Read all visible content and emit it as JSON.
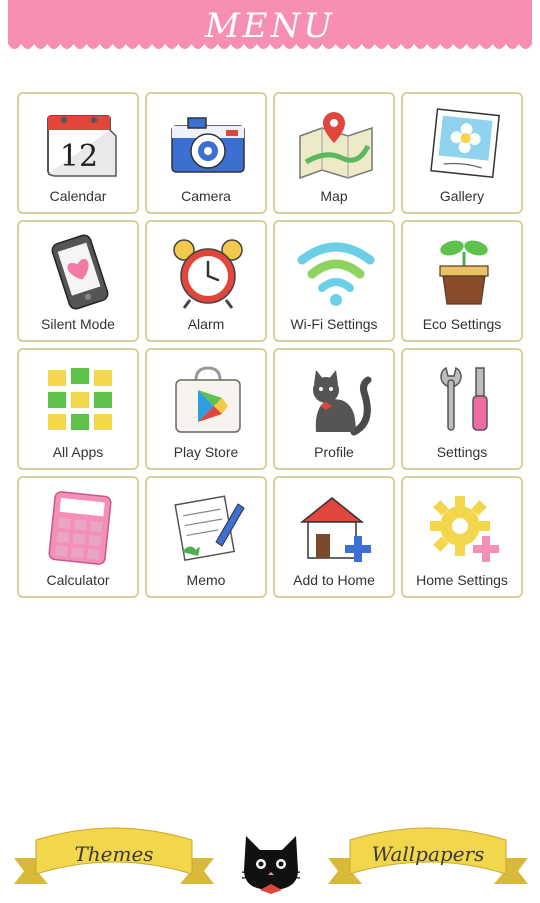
{
  "header": {
    "title": "MENU"
  },
  "apps": [
    {
      "label": "Calendar",
      "icon": "calendar-icon",
      "day": "12"
    },
    {
      "label": "Camera",
      "icon": "camera-icon"
    },
    {
      "label": "Map",
      "icon": "map-icon"
    },
    {
      "label": "Gallery",
      "icon": "gallery-icon"
    },
    {
      "label": "Silent Mode",
      "icon": "phone-heart-icon"
    },
    {
      "label": "Alarm",
      "icon": "alarm-clock-icon"
    },
    {
      "label": "Wi-Fi Settings",
      "icon": "wifi-icon"
    },
    {
      "label": "Eco Settings",
      "icon": "sprout-pot-icon"
    },
    {
      "label": "All Apps",
      "icon": "apps-grid-icon"
    },
    {
      "label": "Play Store",
      "icon": "play-store-icon"
    },
    {
      "label": "Profile",
      "icon": "cat-profile-icon"
    },
    {
      "label": "Settings",
      "icon": "tools-icon"
    },
    {
      "label": "Calculator",
      "icon": "calculator-icon"
    },
    {
      "label": "Memo",
      "icon": "memo-icon"
    },
    {
      "label": "Add to Home",
      "icon": "house-plus-icon"
    },
    {
      "label": "Home Settings",
      "icon": "gear-plus-icon"
    }
  ],
  "footer": {
    "themes_label": "Themes",
    "wallpapers_label": "Wallpapers"
  },
  "colors": {
    "header_pink": "#f78fb3",
    "tile_border": "#d9cd9a",
    "ribbon_yellow": "#f2d64b"
  }
}
